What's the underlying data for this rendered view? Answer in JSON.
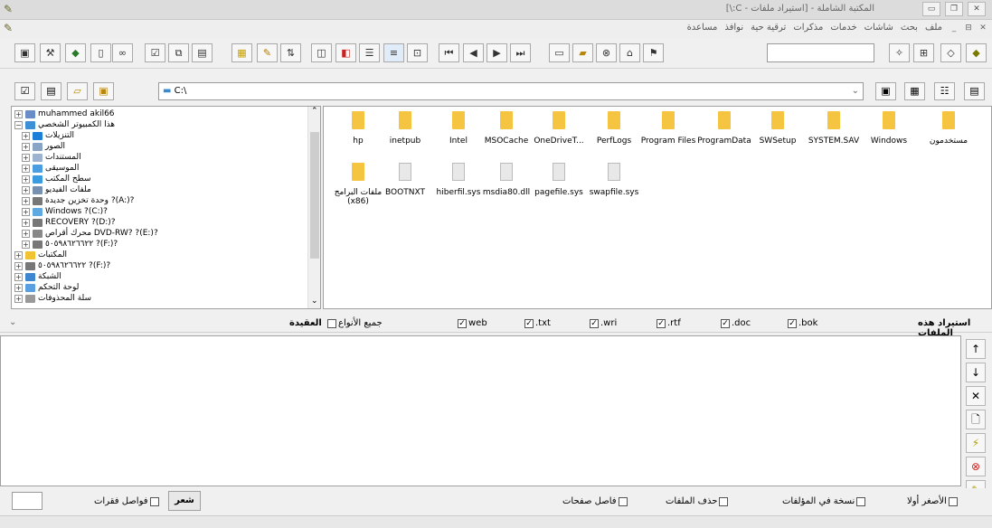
{
  "window": {
    "title": "المكتبة الشاملة - [استيراد ملفات - C:\\]"
  },
  "menu": {
    "items": [
      "ملف",
      "بحث",
      "شاشات",
      "خدمات",
      "مذكرات",
      "ترقية حية",
      "نوافذ",
      "مساعدة"
    ]
  },
  "path": {
    "value": "C:\\"
  },
  "tree": {
    "items": [
      {
        "label": "muhammed akil66",
        "color": "#6a8cc7"
      },
      {
        "label": "هذا الكمبيوتر الشخصي",
        "color": "#3d8fd6"
      },
      {
        "label": "التنزيلات",
        "color": "#1e7fd8"
      },
      {
        "label": "الصور",
        "color": "#8aa4c5"
      },
      {
        "label": "المستندات",
        "color": "#9db3cf"
      },
      {
        "label": "الموسيقى",
        "color": "#4a9de0"
      },
      {
        "label": "سطح المكتب",
        "color": "#3a9be0"
      },
      {
        "label": "ملفات الفيديو",
        "color": "#7790b0"
      },
      {
        "label": "وحدة تخزين جديدة ?(A:)?",
        "color": "#777"
      },
      {
        "label": "Windows ?(C:)?",
        "color": "#5fa8e0"
      },
      {
        "label": "RECOVERY ?(D:)?",
        "color": "#777"
      },
      {
        "label": "محرك أقراص DVD-RW? ?(E:)?",
        "color": "#888"
      },
      {
        "label": "٥٠٥٩٨٦٢٦٦٢٢ ?(F:)?",
        "color": "#777"
      },
      {
        "label": "المكتبات",
        "color": "#f1c232"
      },
      {
        "label": "٥٠٥٩٨٦٢٦٦٢٢ ?(F:)?",
        "color": "#777"
      },
      {
        "label": "الشبكة",
        "color": "#3e86d0"
      },
      {
        "label": "لوحة التحكم",
        "color": "#5aa0e0"
      },
      {
        "label": "سلة المحذوفات",
        "color": "#999"
      }
    ]
  },
  "files": {
    "row1": [
      "hp",
      "inetpub",
      "Intel",
      "MSOCache",
      "OneDriveT...",
      "PerfLogs",
      "Program Files",
      "ProgramData",
      "SWSetup",
      "SYSTEM.SAV",
      "Windows",
      "مستخدمون"
    ],
    "row2": [
      "ملفات البرامج (x86)",
      "BOOTNXT",
      "hiberfil.sys",
      "msdia80.dll",
      "pagefile.sys",
      "swapfile.sys"
    ],
    "row2_kind": [
      "folder",
      "doc",
      "doc",
      "doc",
      "doc",
      "doc"
    ]
  },
  "filters": {
    "import_label": "استيراد هذه الملفات",
    "all_types": "جميع الأنواع",
    "types": [
      ".bok",
      ".doc",
      ".rtf",
      ".wri",
      ".txt",
      "web"
    ],
    "aqida": "العقيدة"
  },
  "side_buttons": [
    "↑",
    "↓",
    "✕",
    "🗋",
    "⚡",
    "⊗",
    "✎"
  ],
  "bottom": {
    "smallest_first": "الأصغر أولا",
    "copy_in_works": "نسخة في المؤلفات",
    "delete_files": "حذف الملفات",
    "page_separator": "فاصل صفحات",
    "poetry": "شعر",
    "paragraph_separators": "فواصل فقرات"
  }
}
